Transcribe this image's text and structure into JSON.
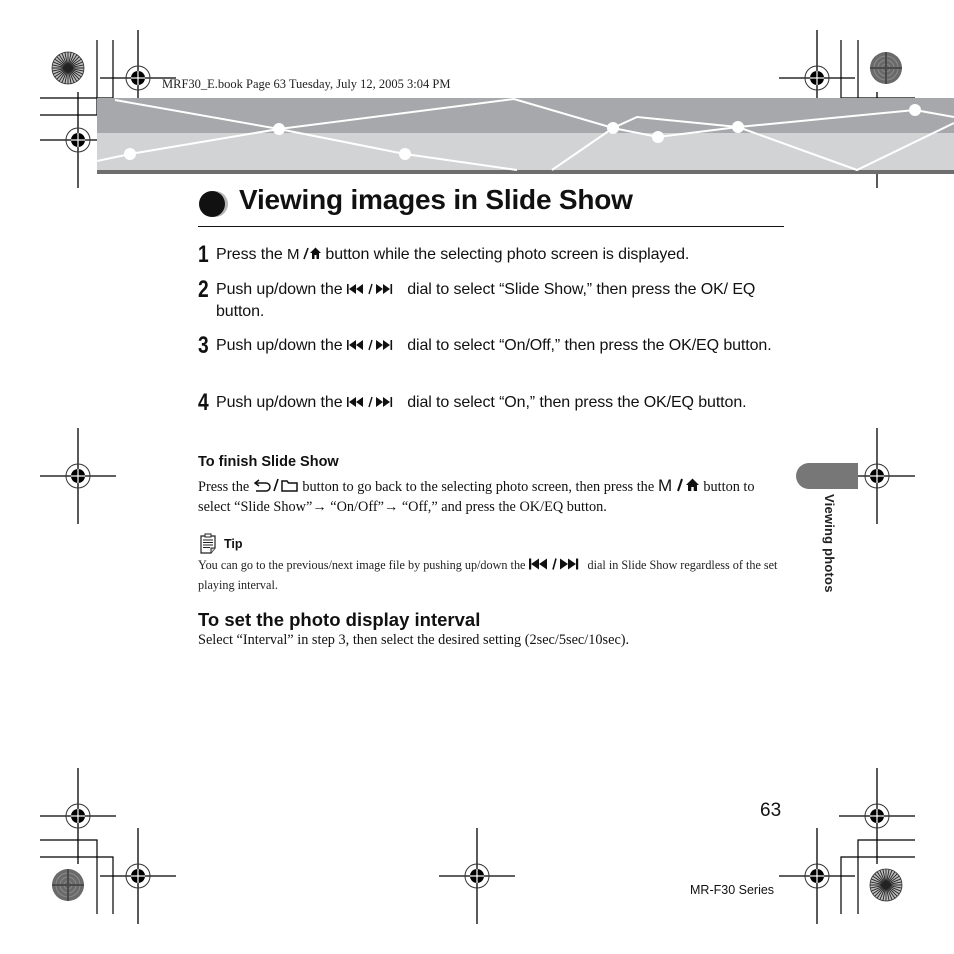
{
  "print_meta": {
    "book_line": "MRF30_E.book  Page 63  Tuesday, July 12, 2005  3:04 PM"
  },
  "header": {
    "title": "Viewing images in Slide Show",
    "band_colors": {
      "upper": "#a7a8ab",
      "lower": "#d2d3d5",
      "rule": "#6e6e6e",
      "line": "#ffffff"
    }
  },
  "steps": [
    {
      "number": "1",
      "parts": [
        "Press the ",
        "[M/home-icon]",
        " button while the selecting photo screen is displayed."
      ],
      "text_before": "Press the ",
      "icon": "menu-home-icon",
      "text_after": " button while the selecting photo screen is displayed."
    },
    {
      "number": "2",
      "text_before": "Push up/down the ",
      "icon": "skip-dial-icon",
      "text_after": " dial to select “Slide Show,” then press the OK/ EQ button."
    },
    {
      "number": "3",
      "text_before": "Push up/down the ",
      "icon": "skip-dial-icon",
      "text_after": " dial to select “On/Off,” then press the OK/EQ button."
    },
    {
      "number": "4",
      "text_before": "Push up/down the ",
      "icon": "skip-dial-icon",
      "text_after": " dial to select “On,” then press the OK/EQ button."
    }
  ],
  "finish": {
    "heading": "To finish Slide Show",
    "text_1": "Press the ",
    "icon_1": "back-folder-icon",
    "text_2": " button to go back to the selecting photo screen, then press the ",
    "icon_2": "menu-home-icon",
    "text_3": " button to select “Slide Show”",
    "arrow": "→",
    "text_4": " “On/Off”",
    "text_5": " “Off,” and press the OK/EQ button."
  },
  "tip": {
    "label": "Tip",
    "text_before": "You can go to the previous/next image file by pushing up/down the ",
    "icon": "skip-dial-icon",
    "text_after": " dial in Slide Show regardless of the set playing interval."
  },
  "interval": {
    "heading": "To set the photo display interval",
    "text": "Select “Interval” in step 3, then select the desired setting (2sec/5sec/10sec)."
  },
  "side_tab": {
    "label": "Viewing photos",
    "color": "#777777"
  },
  "footer": {
    "page_number": "63",
    "series": "MR-F30 Series"
  }
}
